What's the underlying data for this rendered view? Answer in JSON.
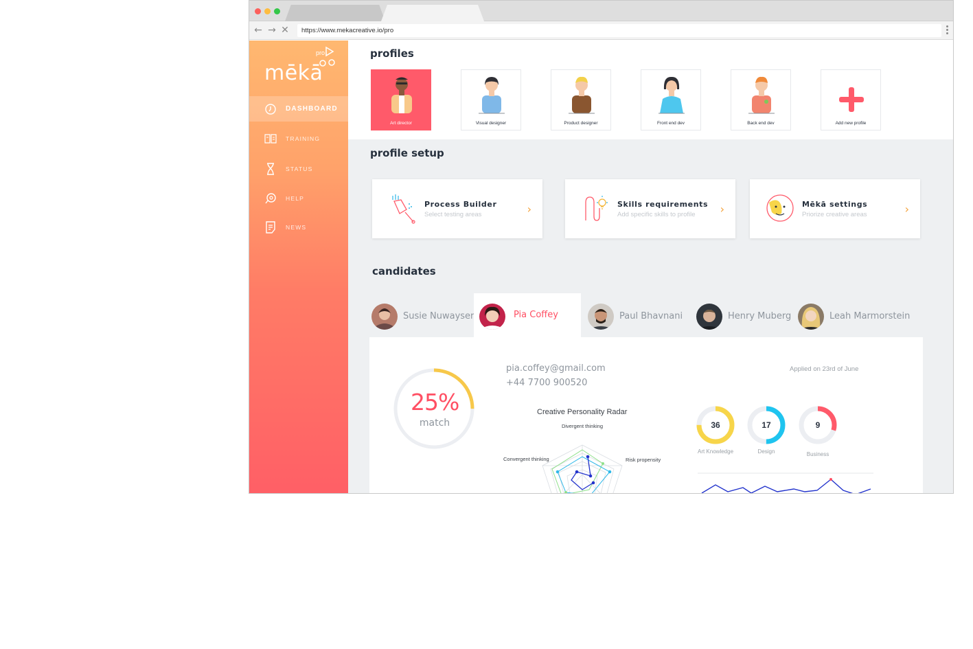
{
  "browser": {
    "url": "https://www.mekacreative.io/pro"
  },
  "sidebar": {
    "logo": "mēkā",
    "logo_badge": "pro",
    "items": [
      {
        "label": "DASHBOARD",
        "icon": "dashboard-icon",
        "active": true
      },
      {
        "label": "TRAINING",
        "icon": "book-icon",
        "active": false
      },
      {
        "label": "STATUS",
        "icon": "hourglass-icon",
        "active": false
      },
      {
        "label": "HELP",
        "icon": "help-icon",
        "active": false
      },
      {
        "label": "NEWS",
        "icon": "news-icon",
        "active": false
      }
    ]
  },
  "profiles": {
    "title": "profiles",
    "items": [
      {
        "label": "Art director",
        "active": true
      },
      {
        "label": "Visual designer",
        "active": false
      },
      {
        "label": "Product designer",
        "active": false
      },
      {
        "label": "Front end dev",
        "active": false
      },
      {
        "label": "Back end dev",
        "active": false
      },
      {
        "label": "Add new profile",
        "active": false
      }
    ]
  },
  "profile_setup": {
    "title": "profile setup",
    "cards": [
      {
        "title": "Process Builder",
        "subtitle": "Select testing areas",
        "icon": "process-builder-icon"
      },
      {
        "title": "Skills requirements",
        "subtitle": "Add specific skills to profile",
        "icon": "skills-icon"
      },
      {
        "title": "Mēkā settings",
        "subtitle": "Priorize creative areas",
        "icon": "settings-face-icon"
      }
    ]
  },
  "candidates": {
    "title": "candidates",
    "tabs": [
      {
        "name": "Susie Nuwayser",
        "active": false
      },
      {
        "name": "Pia Coffey",
        "active": true
      },
      {
        "name": "Paul Bhavnani",
        "active": false
      },
      {
        "name": "Henry Muberg",
        "active": false
      },
      {
        "name": "Leah Marmorstein",
        "active": false
      }
    ],
    "selected": {
      "email": "pia.coffey@gmail.com",
      "phone": "+44 7700 900520",
      "applied": "Applied on 23rd of June",
      "match_value": "25%",
      "match_label": "match",
      "match_fraction": 0.25,
      "radar_title": "Creative Personality Radar",
      "radar_axes": [
        "Divergent thinking",
        "Risk propensity",
        "Convergent thinking"
      ],
      "scores": [
        {
          "label": "Art Knowledge",
          "value": "36",
          "fraction": 0.75,
          "color": "#f7d54a"
        },
        {
          "label": "Design",
          "value": "17",
          "fraction": 0.5,
          "color": "#1fc4ef"
        },
        {
          "label": "Business",
          "value": "9",
          "fraction": 0.3,
          "color": "#ff5a6a"
        }
      ]
    }
  },
  "colors": {
    "accent": "#ff5a6a",
    "chevron": "#f4a23a",
    "sidebar_top": "#ffb870",
    "sidebar_bottom": "#ff5f66"
  }
}
